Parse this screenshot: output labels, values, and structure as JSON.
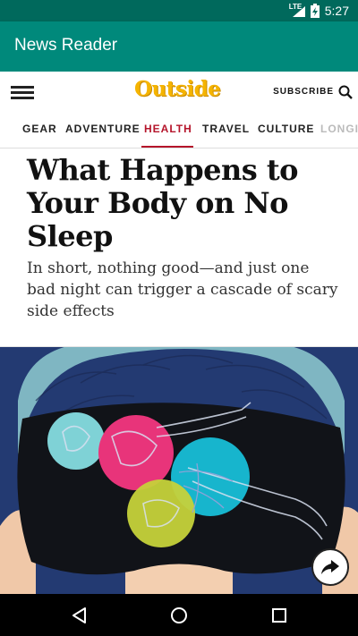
{
  "status_bar": {
    "network": "LTE",
    "time": "5:27"
  },
  "app_bar": {
    "title": "News Reader"
  },
  "site_header": {
    "logo": "Outside",
    "subscribe_label": "SUBSCRIBE"
  },
  "nav": {
    "items": [
      {
        "label": "GEAR"
      },
      {
        "label": "ADVENTURE"
      },
      {
        "label": "HEALTH"
      },
      {
        "label": "TRAVEL"
      },
      {
        "label": "CULTURE"
      },
      {
        "label": "LONGI"
      }
    ],
    "active": "HEALTH"
  },
  "article": {
    "headline": "What Happens to Your Body on No Sleep",
    "dek": "In short, nothing good—and just one bad night can trigger a cascade of scary side effects"
  },
  "colors": {
    "status_bar": "#00695c",
    "app_bar": "#00897b",
    "accent": "#b5152b",
    "logo": "#f5b400"
  }
}
